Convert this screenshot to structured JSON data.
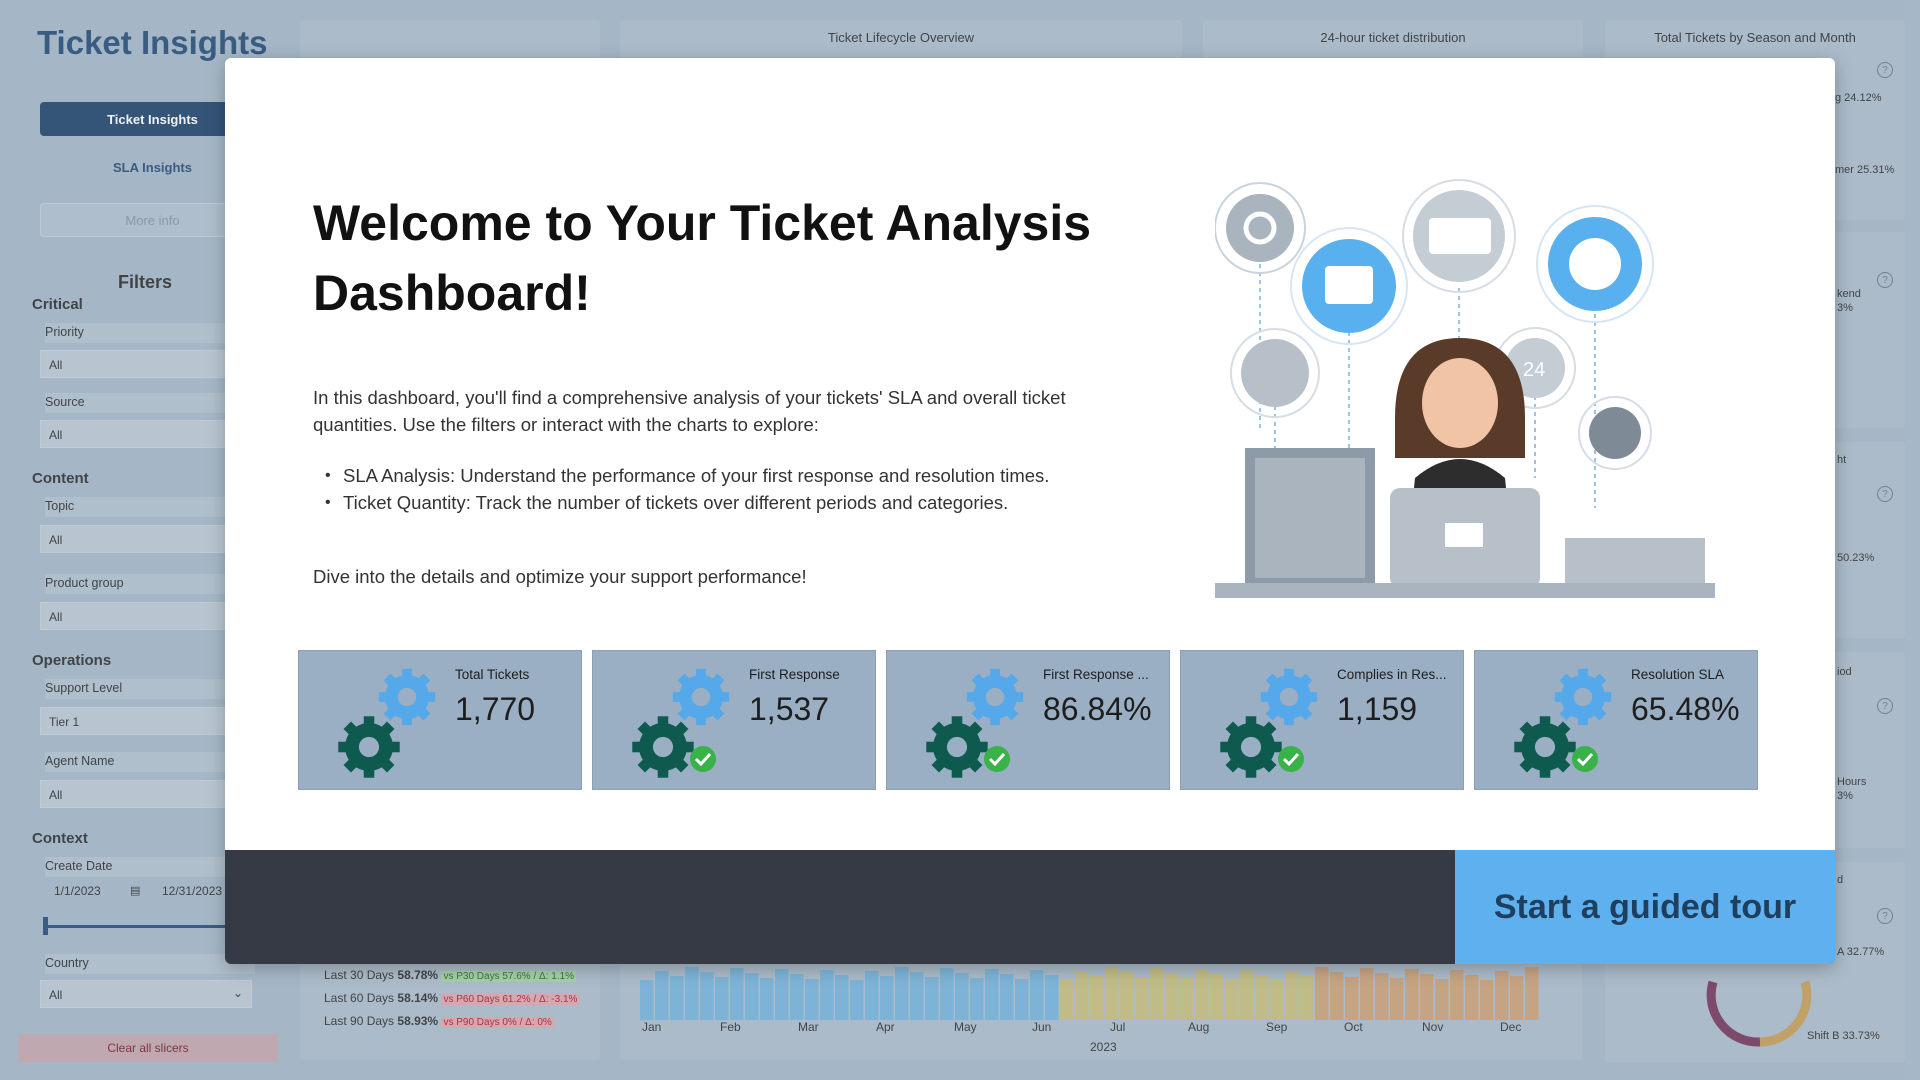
{
  "sidebar": {
    "title": "Ticket Insights",
    "nav": {
      "active": "Ticket Insights",
      "sla": "SLA Insights",
      "more": "More info"
    },
    "filters_title": "Filters",
    "groups": {
      "critical": "Critical",
      "content": "Content",
      "operations": "Operations",
      "context": "Context"
    },
    "slicers": {
      "priority": {
        "label": "Priority",
        "value": "All"
      },
      "source": {
        "label": "Source",
        "value": "All"
      },
      "topic": {
        "label": "Topic",
        "value": "All"
      },
      "product_group": {
        "label": "Product group",
        "value": "All"
      },
      "support_level": {
        "label": "Support Level",
        "value": "Tier 1"
      },
      "agent_name": {
        "label": "Agent Name",
        "value": "All"
      },
      "create_date": {
        "label": "Create Date",
        "start": "1/1/2023",
        "end": "12/31/2023"
      },
      "country": {
        "label": "Country",
        "value": "All"
      }
    },
    "clear_label": "Clear all slicers"
  },
  "panels": {
    "lifecycle": "Ticket Lifecycle Overview",
    "distribution": "24-hour ticket distribution",
    "season": "Total Tickets by Season and Month",
    "season_pct1": "g 24.12%",
    "season_pct2": "mer 25.31%",
    "right2_a": "kend",
    "right2_b": "3%",
    "right3_a": "ht",
    "right3_b": "50.23%",
    "right4_a": "iod",
    "right4_b": "Hours",
    "right4_c": "3%",
    "right5_a": "d",
    "right5_b": "A 32.77%",
    "right5_c": "Shift B 33.73%"
  },
  "stats": [
    {
      "period": "Last 30 Days",
      "value": "58.78%",
      "compare": "vs P30 Days 57.6% / Δ: 1.1%",
      "tone": "good"
    },
    {
      "period": "Last 60 Days",
      "value": "58.14%",
      "compare": "vs P60 Days 61.2% / Δ: -3.1%",
      "tone": "bad"
    },
    {
      "period": "Last 90 Days",
      "value": "58.93%",
      "compare": "vs P90 Days 0% / Δ: 0%",
      "tone": "bad"
    }
  ],
  "months": [
    "Jan",
    "Feb",
    "Mar",
    "Apr",
    "May",
    "Jun",
    "Jul",
    "Aug",
    "Sep",
    "Oct",
    "Nov",
    "Dec"
  ],
  "year": "2023",
  "modal": {
    "title": "Welcome to Your Ticket Analysis Dashboard!",
    "intro": "In this dashboard, you'll find a comprehensive analysis of your tickets' SLA and overall ticket quantities. Use the filters or interact with the charts to explore:",
    "bullets": [
      "SLA Analysis: Understand the performance of your first response and resolution times.",
      "Ticket Quantity: Track the number of tickets over different periods and categories."
    ],
    "outro": "Dive into the details and optimize your support performance!",
    "tour_label": "Start a guided tour"
  },
  "kpis": [
    {
      "label": "Total Tickets",
      "value": "1,770",
      "check": false
    },
    {
      "label": "First Response",
      "value": "1,537",
      "check": true
    },
    {
      "label": "First Response ...",
      "value": "86.84%",
      "check": true
    },
    {
      "label": "Complies in Res...",
      "value": "1,159",
      "check": true
    },
    {
      "label": "Resolution SLA",
      "value": "65.48%",
      "check": true
    }
  ],
  "colors": {
    "gear_dark": "#0f5a4f",
    "gear_light": "#55a8ea",
    "check": "#3ab24a",
    "tour_button": "#5fb0ef",
    "nav_active": "#24466d"
  }
}
